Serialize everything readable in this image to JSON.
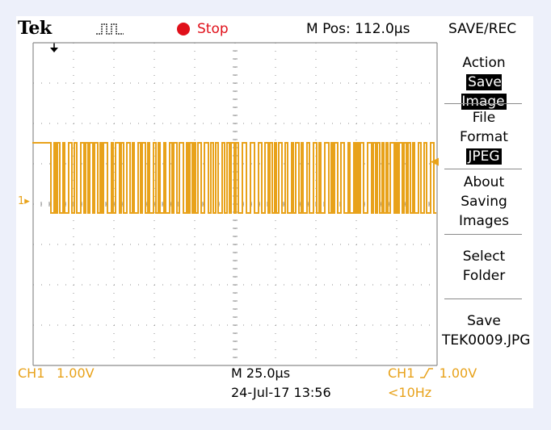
{
  "header": {
    "brand": "Tek",
    "acquisition_icon": "pulse-waveform-icon",
    "run_state": "Stop",
    "run_state_color": "#e0101a",
    "position_readout": "M Pos: 112.0µs"
  },
  "side_menu": {
    "title": "SAVE/REC",
    "action_label": "Action",
    "action_value": "Save Image",
    "file_format_label_1": "File",
    "file_format_label_2": "Format",
    "file_format_value": "JPEG",
    "about_1": "About",
    "about_2": "Saving",
    "about_3": "Images",
    "select_1": "Select",
    "select_2": "Folder",
    "save_label": "Save",
    "save_filename": "TEK0009.JPG"
  },
  "status_bar": {
    "channel": "CH1",
    "volts_per_div": "1.00V",
    "timebase": "M 25.0µs",
    "datetime": "24-Jul-17 13:56",
    "trigger_channel": "CH1",
    "trigger_slope_icon": "rising-edge-icon",
    "trigger_level": "1.00V",
    "trigger_frequency": "<10Hz"
  },
  "screen": {
    "channel_marker": "1",
    "trace_color": "#e8a21a",
    "grid_color": "#8c8c8c"
  }
}
